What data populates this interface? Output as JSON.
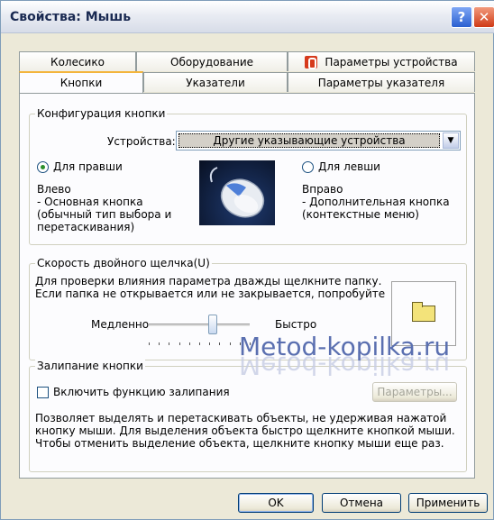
{
  "window": {
    "title": "Свойства: Мышь",
    "help_glyph": "?",
    "close_glyph": "✕"
  },
  "tabs": {
    "row1": [
      "Колесико",
      "Оборудование",
      "Параметры устройства"
    ],
    "row2": [
      "Кнопки",
      "Указатели",
      "Параметры указателя"
    ],
    "active": "Кнопки"
  },
  "button_config": {
    "legend": "Конфигурация кнопки",
    "devices_label": "Устройства:",
    "devices_value": "Другие указывающие устройства",
    "right_hand_label": "Для правши",
    "right_hand_checked": true,
    "left_hand_label": "Для левши",
    "left_hand_checked": false,
    "left_title": "Влево",
    "left_desc": "- Основная кнопка (обычный тип выбора и перетаскивания)",
    "right_title": "Вправо",
    "right_desc": "- Дополнительная кнопка (контекстные меню)"
  },
  "double_click": {
    "legend": "Скорость двойного щелчка(U)",
    "text_line1": "Для проверки влияния параметра дважды щелкните папку.",
    "text_line2": "Если папка не открывается или не закрывается, попробуйте",
    "slow_label": "Медленно",
    "fast_label": "Быстро",
    "slider_value_fraction": 0.63
  },
  "click_lock": {
    "legend": "Залипание кнопки",
    "enable_label": "Включить функцию залипания",
    "enabled": false,
    "settings_button": "Параметры...",
    "description": "Позволяет выделять и перетаскивать объекты, не удерживая нажатой кнопку мыши. Для выделения объекта быстро щелкните кнопкой мыши. Чтобы отменить выделение объекта, щелкните кнопку мыши еще раз."
  },
  "watermark": "Metod-kopilka.ru",
  "footer": {
    "ok": "OK",
    "cancel": "Отмена",
    "apply": "Применить"
  }
}
